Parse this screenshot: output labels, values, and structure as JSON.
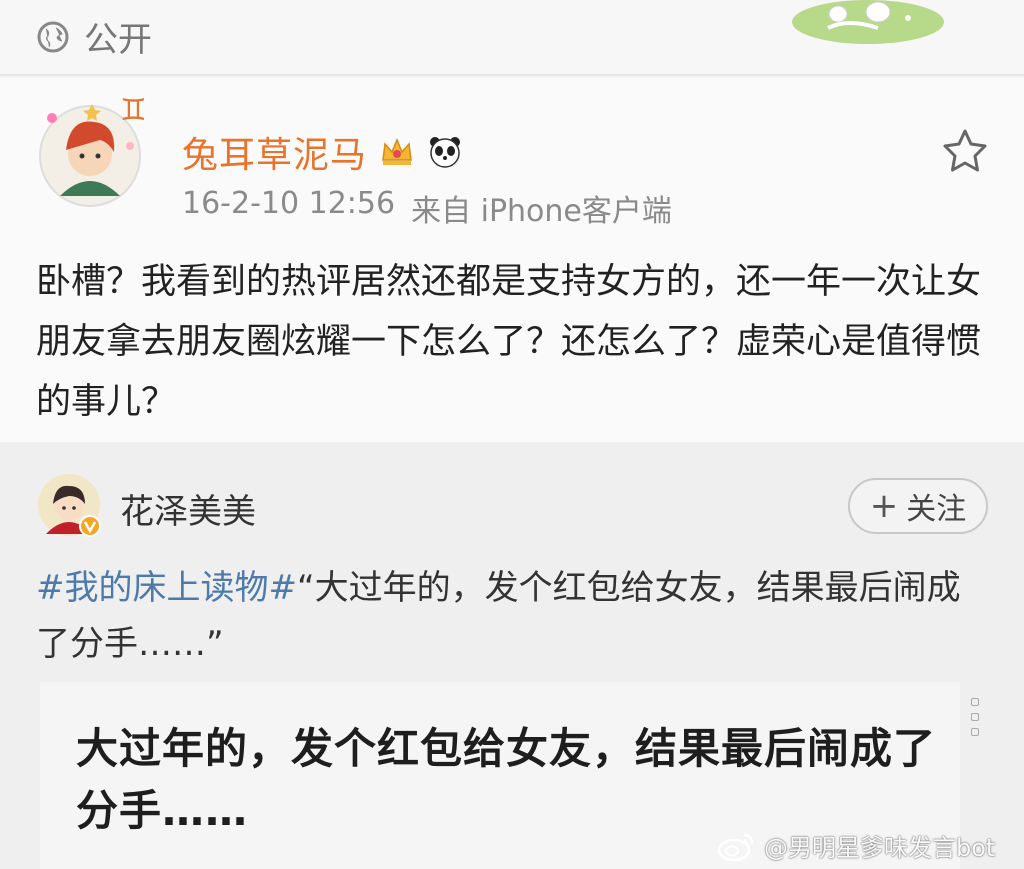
{
  "header": {
    "visibility_icon": "globe-icon",
    "visibility_label": "公开"
  },
  "post": {
    "author": "兔耳草泥马",
    "badges": [
      "crown-icon",
      "panda-icon"
    ],
    "timestamp": "16-2-10 12:56",
    "source": "来自 iPhone客户端",
    "text": "卧槽？我看到的热评居然还都是支持女方的，还一年一次让女朋友拿去朋友圈炫耀一下怎么了？还怎么了？虚荣心是值得惯的事儿？",
    "favorite_icon": "star-outline-icon",
    "name_color": "#e8742c"
  },
  "repost": {
    "author": "花泽美美",
    "verified_icon": "verified-v-icon",
    "follow_label": "关注",
    "follow_icon": "plus-icon",
    "hashtag": "#我的床上读物#",
    "text": "“大过年的，发个红包给女友，结果最后闹成了分手……”",
    "hashtag_color": "#4d7aa8"
  },
  "article": {
    "title": "大过年的，发个红包给女友，结果最后闹成了分手……"
  },
  "watermark": {
    "icon": "weibo-logo-icon",
    "text": "@男明星爹味发言bot"
  }
}
